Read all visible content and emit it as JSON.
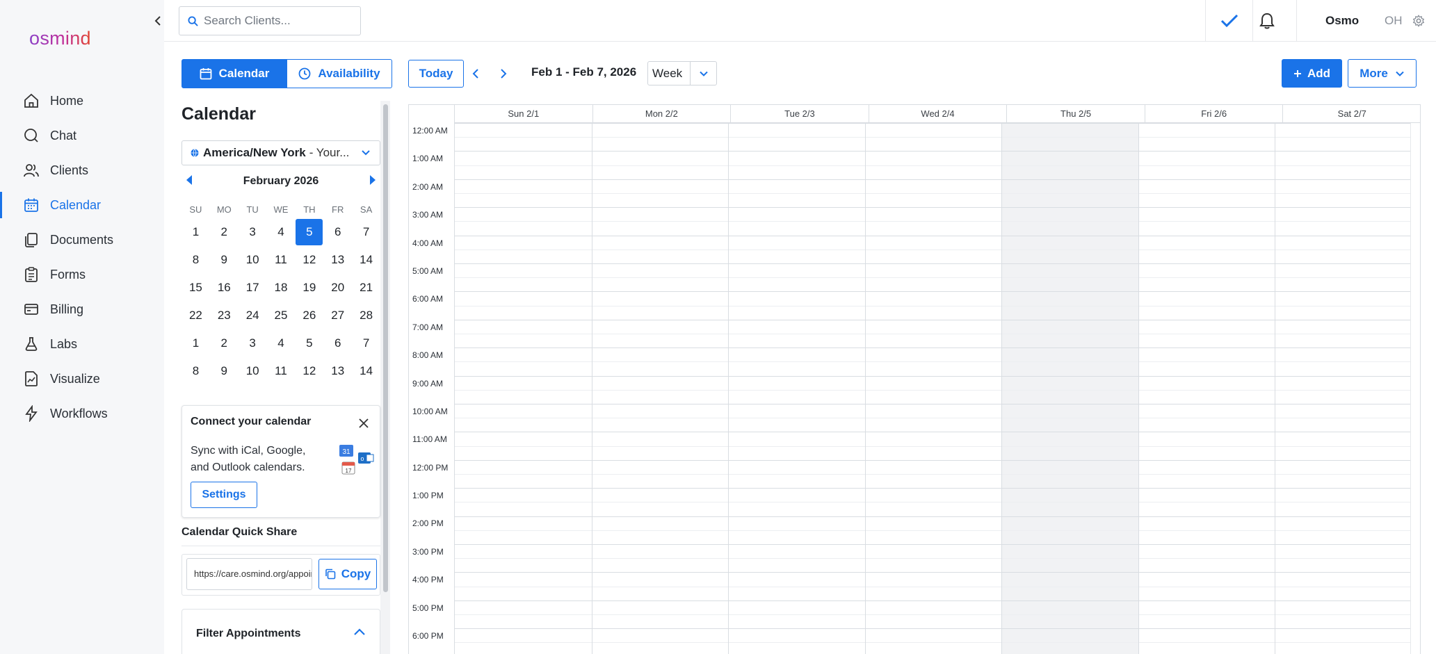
{
  "app": {
    "logo": "osmind",
    "search_placeholder": "Search Clients..."
  },
  "sidebar": {
    "items": [
      {
        "label": "Home",
        "icon": "home-icon"
      },
      {
        "label": "Chat",
        "icon": "chat-icon"
      },
      {
        "label": "Clients",
        "icon": "clients-icon"
      },
      {
        "label": "Calendar",
        "icon": "calendar-icon",
        "active": true
      },
      {
        "label": "Documents",
        "icon": "documents-icon"
      },
      {
        "label": "Forms",
        "icon": "forms-icon"
      },
      {
        "label": "Billing",
        "icon": "billing-icon"
      },
      {
        "label": "Labs",
        "icon": "labs-icon"
      },
      {
        "label": "Visualize",
        "icon": "visualize-icon"
      },
      {
        "label": "Workflows",
        "icon": "workflows-icon"
      }
    ]
  },
  "header": {
    "user_name": "Osmo",
    "user_initials": "OH"
  },
  "view_toggle": {
    "calendar_label": "Calendar",
    "availability_label": "Availability"
  },
  "panel": {
    "title": "Calendar",
    "timezone_main": "America/New York",
    "timezone_rest": "- Your..."
  },
  "mini_calendar": {
    "month_label": "February 2026",
    "weekdays": [
      "SU",
      "MO",
      "TU",
      "WE",
      "TH",
      "FR",
      "SA"
    ],
    "weeks": [
      [
        "1",
        "2",
        "3",
        "4",
        "5",
        "6",
        "7"
      ],
      [
        "8",
        "9",
        "10",
        "11",
        "12",
        "13",
        "14"
      ],
      [
        "15",
        "16",
        "17",
        "18",
        "19",
        "20",
        "21"
      ],
      [
        "22",
        "23",
        "24",
        "25",
        "26",
        "27",
        "28"
      ],
      [
        "1",
        "2",
        "3",
        "4",
        "5",
        "6",
        "7"
      ],
      [
        "8",
        "9",
        "10",
        "11",
        "12",
        "13",
        "14"
      ]
    ],
    "selected": "5"
  },
  "connect_card": {
    "title": "Connect your calendar",
    "text": "Sync with iCal, Google, and Outlook calendars.",
    "button_label": "Settings",
    "google_badge": "31",
    "ical_badge": "17",
    "outlook_badge": "o"
  },
  "quick_share": {
    "title": "Calendar Quick Share",
    "url": "https://care.osmind.org/appointments",
    "copy_label": "Copy"
  },
  "filter": {
    "title": "Filter Appointments"
  },
  "toolbar": {
    "today_label": "Today",
    "date_range": "Feb 1 - Feb 7, 2026",
    "view_label": "Week",
    "add_label": "Add",
    "more_label": "More"
  },
  "week": {
    "days": [
      "Sun 2/1",
      "Mon 2/2",
      "Tue 2/3",
      "Wed 2/4",
      "Thu 2/5",
      "Fri 2/6",
      "Sat 2/7"
    ],
    "times": [
      "12:00 AM",
      "1:00 AM",
      "2:00 AM",
      "3:00 AM",
      "4:00 AM",
      "5:00 AM",
      "6:00 AM",
      "7:00 AM",
      "8:00 AM",
      "9:00 AM",
      "10:00 AM",
      "11:00 AM",
      "12:00 PM",
      "1:00 PM",
      "2:00 PM",
      "3:00 PM",
      "4:00 PM",
      "5:00 PM",
      "6:00 PM"
    ],
    "today_index": 4
  },
  "colors": {
    "accent": "#1a73e8",
    "logo_gradient": [
      "#8a3fc7",
      "#c1309b",
      "#e2452f"
    ]
  }
}
